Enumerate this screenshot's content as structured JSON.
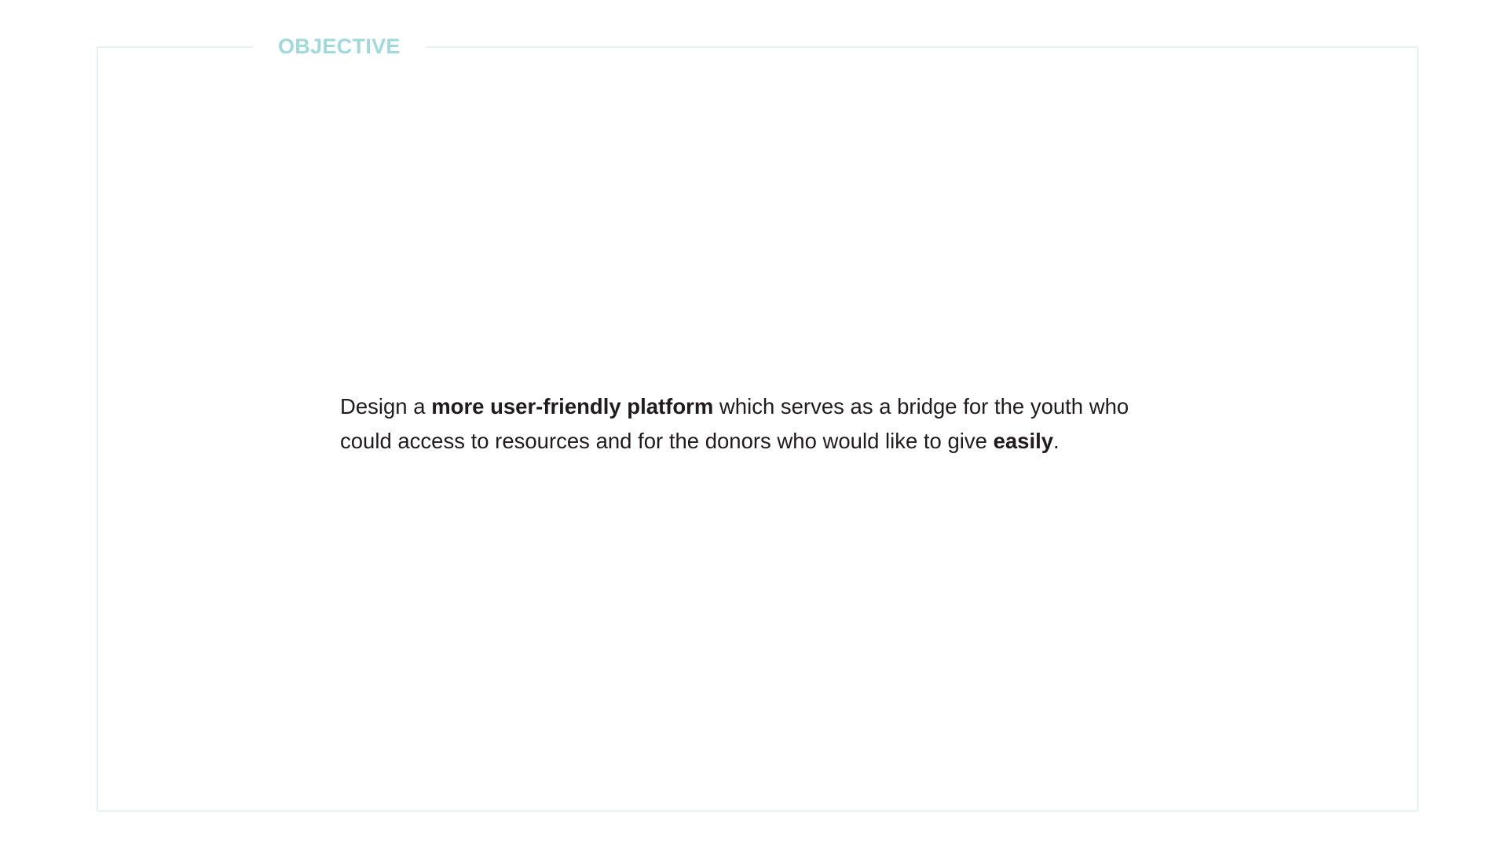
{
  "section": {
    "title": "OBJECTIVE"
  },
  "objective": {
    "line1_prefix": "Design a ",
    "line1_emphasis": "more user-friendly platform",
    "line1_suffix": " which serves as a bridge for the youth who",
    "line2_prefix": "could access to resources and for the donors who would like to give ",
    "line2_emphasis": "easily",
    "line2_suffix": "."
  },
  "colors": {
    "title": "#9fd9d9",
    "frame_border": "#e3f3f3",
    "body_text": "#231a1c",
    "background": "#ffffff"
  }
}
